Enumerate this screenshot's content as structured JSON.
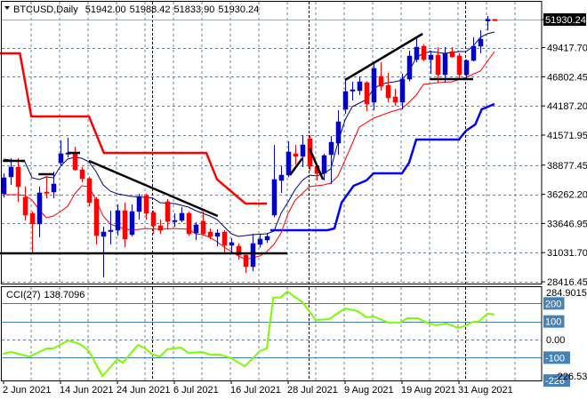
{
  "header": {
    "symbol": "BTCUSD,Daily",
    "open": "51942.00",
    "high": "51988.42",
    "low": "51833.90",
    "close": "51930.24"
  },
  "colors": {
    "bull": "#0000c8",
    "bear": "#ff0000",
    "ma_fast": "#000080",
    "ma_slow": "#ff0000",
    "stop_red": "#ff0000",
    "stop_blue": "#0000ff",
    "cci": "#7cfc00",
    "cci_level": "#4682b4",
    "grid": "#708090"
  },
  "chart_data": [
    {
      "type": "candlestick",
      "title": "BTCUSD,Daily",
      "price_ticks": [
        "51930.24",
        "49417.70",
        "46802.45",
        "44187.20",
        "41571.95",
        "38877.45",
        "36262.20",
        "33646.95",
        "31031.70",
        "28416.45"
      ],
      "current_price": "51930.24",
      "ylim": [
        28416.45,
        51930.24
      ],
      "x_labels": [
        {
          "bar": 1,
          "label": "2 Jun 2021"
        },
        {
          "bar": 9,
          "label": "14 Jun 2021"
        },
        {
          "bar": 17,
          "label": "24 Jun 2021"
        },
        {
          "bar": 25,
          "label": "6 Jul 2021"
        },
        {
          "bar": 33,
          "label": "16 Jul 2021"
        },
        {
          "bar": 41,
          "label": "28 Jul 2021"
        },
        {
          "bar": 49,
          "label": "9 Aug 2021"
        },
        {
          "bar": 57,
          "label": "19 Aug 2021"
        },
        {
          "bar": 65,
          "label": "31 Aug 2021"
        }
      ],
      "period_separators_bar": [
        21.9,
        43.9,
        65.9
      ],
      "ohlc": [
        [
          36309,
          38142,
          35990,
          37743
        ],
        [
          37823,
          39497,
          37105,
          38700
        ],
        [
          38700,
          39497,
          35592,
          36946
        ],
        [
          35990,
          36946,
          33918,
          34396
        ],
        [
          34555,
          34714,
          30969,
          33599
        ],
        [
          33599,
          36946,
          32403,
          36388
        ],
        [
          36468,
          37902,
          35910,
          36388
        ],
        [
          36468,
          38301,
          35910,
          37185
        ],
        [
          39098,
          41091,
          38779,
          39895
        ],
        [
          39895,
          41330,
          39576,
          39975
        ],
        [
          39975,
          40533,
          38380,
          38460
        ],
        [
          38460,
          38700,
          37345,
          37663
        ],
        [
          37663,
          37823,
          35193,
          35512
        ],
        [
          35831,
          35990,
          31766,
          32562
        ],
        [
          32483,
          33360,
          28819,
          32881
        ],
        [
          33000,
          34794,
          31766,
          33041
        ],
        [
          33041,
          35352,
          32562,
          34794
        ],
        [
          34794,
          35512,
          31527,
          32244
        ],
        [
          32642,
          35352,
          32483,
          34714
        ],
        [
          34714,
          36309,
          33997,
          36070
        ],
        [
          36149,
          36309,
          33997,
          34555
        ],
        [
          34635,
          34794,
          32722,
          33439
        ],
        [
          33439,
          33997,
          32722,
          33041
        ],
        [
          35592,
          35831,
          33120,
          33838
        ],
        [
          33838,
          34555,
          33360,
          33918
        ],
        [
          33918,
          35113,
          33758,
          34555
        ],
        [
          34555,
          34714,
          32562,
          32722
        ],
        [
          32802,
          33758,
          32164,
          33519
        ],
        [
          33838,
          34714,
          32562,
          32722
        ],
        [
          32881,
          33200,
          32244,
          32483
        ],
        [
          32483,
          33120,
          31606,
          32802
        ],
        [
          32881,
          33041,
          31049,
          31686
        ],
        [
          31686,
          32324,
          30969,
          31925
        ],
        [
          31606,
          31845,
          30410,
          30810
        ],
        [
          30810,
          31049,
          29215,
          29773
        ],
        [
          29773,
          32722,
          29374,
          31845
        ],
        [
          31766,
          32722,
          31500,
          32244
        ],
        [
          32164,
          32802,
          31900,
          32483
        ],
        [
          34396,
          40692,
          34200,
          37584
        ],
        [
          37504,
          38779,
          36388,
          37982
        ],
        [
          37982,
          41011,
          37800,
          40054
        ],
        [
          39895,
          40692,
          38939,
          39656
        ],
        [
          39656,
          41569,
          38700,
          40692
        ],
        [
          41250,
          41569,
          38380,
          38779
        ],
        [
          38779,
          38900,
          37504,
          38142
        ],
        [
          38142,
          39895,
          37504,
          39736
        ],
        [
          39815,
          41489,
          37185,
          40931
        ],
        [
          40851,
          43800,
          39815,
          42764
        ],
        [
          43880,
          46590,
          43481,
          45474
        ],
        [
          45554,
          46351,
          44677,
          45633
        ],
        [
          45554,
          46829,
          45155,
          46351
        ],
        [
          46271,
          46400,
          43721,
          44358
        ],
        [
          44517,
          48104,
          43800,
          47546
        ],
        [
          46829,
          48104,
          45554,
          45952
        ],
        [
          46032,
          47148,
          44517,
          44916
        ],
        [
          44996,
          45713,
          44200,
          44517
        ],
        [
          44517,
          47068,
          43880,
          46590
        ],
        [
          46590,
          49140,
          46400,
          48662
        ],
        [
          48343,
          50415,
          48104,
          49459
        ],
        [
          49539,
          49698,
          48200,
          48343
        ],
        [
          48343,
          49140,
          47068,
          48742
        ],
        [
          48742,
          49459,
          46271,
          46988
        ],
        [
          46988,
          49459,
          46271,
          48901
        ],
        [
          49060,
          49459,
          48500,
          48582
        ],
        [
          48662,
          48901,
          46670,
          46988
        ],
        [
          46988,
          48343,
          46510,
          48263
        ],
        [
          48263,
          50336,
          48183,
          49539
        ],
        [
          49539,
          50973,
          48901,
          50176
        ],
        [
          51800,
          52248,
          50973,
          51950
        ],
        [
          51942.0,
          51988.42,
          51833.9,
          51930.24
        ]
      ],
      "ma_fast": [
        [
          1,
          39417
        ],
        [
          4,
          39178
        ],
        [
          5,
          37743
        ],
        [
          6,
          37584
        ],
        [
          7,
          37823
        ],
        [
          8,
          37743
        ],
        [
          9,
          38779
        ],
        [
          10,
          39417
        ],
        [
          11,
          39576
        ],
        [
          12,
          39497
        ],
        [
          13,
          39178
        ],
        [
          14,
          38301
        ],
        [
          15,
          37105
        ],
        [
          16,
          36548
        ],
        [
          17,
          36309
        ],
        [
          19,
          36070
        ],
        [
          21,
          35990
        ],
        [
          22,
          35910
        ],
        [
          23,
          35512
        ],
        [
          25,
          35432
        ],
        [
          26,
          35272
        ],
        [
          27,
          35113
        ],
        [
          28,
          34794
        ],
        [
          29,
          34555
        ],
        [
          30,
          34316
        ],
        [
          31,
          33997
        ],
        [
          32,
          33360
        ],
        [
          33,
          32722
        ],
        [
          34,
          32483
        ],
        [
          36,
          32642
        ],
        [
          38,
          32722
        ],
        [
          39,
          32961
        ],
        [
          40,
          34555
        ],
        [
          41,
          35592
        ],
        [
          42,
          36707
        ],
        [
          43,
          37504
        ],
        [
          44,
          37982
        ],
        [
          45,
          37902
        ],
        [
          46,
          38142
        ],
        [
          47,
          38540
        ],
        [
          48,
          40931
        ],
        [
          49,
          42924
        ],
        [
          50,
          44119
        ],
        [
          51,
          44438
        ],
        [
          52,
          44757
        ],
        [
          53,
          45713
        ],
        [
          54,
          46112
        ],
        [
          55,
          46271
        ],
        [
          56,
          46351
        ],
        [
          57,
          46510
        ],
        [
          58,
          47307
        ],
        [
          59,
          48502
        ],
        [
          60,
          48901
        ],
        [
          61,
          49060
        ],
        [
          63,
          48901
        ],
        [
          65,
          49060
        ],
        [
          66,
          49060
        ],
        [
          67,
          49539
        ],
        [
          68,
          50336
        ],
        [
          69,
          50655
        ],
        [
          70,
          50814
        ]
      ],
      "ma_slow": [
        [
          1,
          36229
        ],
        [
          3,
          36229
        ],
        [
          4,
          36149
        ],
        [
          5,
          35750
        ],
        [
          6,
          34874
        ],
        [
          7,
          34157
        ],
        [
          8,
          34316
        ],
        [
          9,
          34714
        ],
        [
          10,
          35193
        ],
        [
          11,
          36309
        ],
        [
          12,
          37026
        ],
        [
          13,
          36946
        ],
        [
          14,
          35750
        ],
        [
          15,
          34316
        ],
        [
          16,
          33599
        ],
        [
          17,
          33360
        ],
        [
          19,
          33041
        ],
        [
          21,
          33200
        ],
        [
          23,
          33120
        ],
        [
          25,
          33200
        ],
        [
          27,
          33120
        ],
        [
          28,
          32722
        ],
        [
          29,
          32642
        ],
        [
          30,
          32403
        ],
        [
          31,
          32005
        ],
        [
          32,
          31527
        ],
        [
          33,
          31128
        ],
        [
          34,
          30729
        ],
        [
          35,
          30410
        ],
        [
          36,
          30570
        ],
        [
          37,
          30729
        ],
        [
          38,
          31128
        ],
        [
          39,
          31766
        ],
        [
          40,
          32802
        ],
        [
          41,
          34555
        ],
        [
          42,
          35750
        ],
        [
          44,
          36946
        ],
        [
          46,
          37105
        ],
        [
          47,
          37265
        ],
        [
          48,
          37902
        ],
        [
          49,
          39337
        ],
        [
          51,
          42286
        ],
        [
          53,
          43083
        ],
        [
          55,
          43561
        ],
        [
          57,
          43960
        ],
        [
          58,
          44517
        ],
        [
          59,
          45155
        ],
        [
          60,
          46112
        ],
        [
          62,
          46271
        ],
        [
          64,
          46351
        ],
        [
          66,
          46749
        ],
        [
          68,
          47307
        ],
        [
          70,
          49060
        ]
      ],
      "stop_red": [
        [
          0.5,
          48901
        ],
        [
          3.3,
          48901
        ],
        [
          4.9,
          43243
        ],
        [
          13,
          43243
        ],
        [
          15.1,
          39975
        ],
        [
          29.5,
          39975
        ],
        [
          31,
          37600
        ],
        [
          35,
          35432
        ],
        [
          38,
          35432
        ]
      ],
      "stop_blue": [
        [
          38.5,
          33041
        ],
        [
          46.5,
          33041
        ],
        [
          47.5,
          33200
        ],
        [
          48.5,
          35512
        ],
        [
          50.2,
          37026
        ],
        [
          52,
          37504
        ],
        [
          53,
          38142
        ],
        [
          57,
          38142
        ],
        [
          58,
          39098
        ],
        [
          59,
          41170
        ],
        [
          65,
          41170
        ],
        [
          66,
          41968
        ],
        [
          67.3,
          42525
        ],
        [
          68.2,
          43880
        ],
        [
          70,
          44358
        ]
      ],
      "trendlines": [
        [
          [
            0.9,
            39257
          ],
          [
            4,
            39257
          ]
        ],
        [
          [
            5.9,
            38062
          ],
          [
            8,
            38062
          ]
        ],
        [
          [
            10,
            39975
          ],
          [
            11.75,
            39975
          ]
        ],
        [
          [
            13,
            39257
          ],
          [
            31.1,
            34316
          ]
        ],
        [
          [
            0.5,
            30969
          ],
          [
            40.9,
            30969
          ]
        ],
        [
          [
            41.25,
            37982
          ],
          [
            43,
            39497
          ]
        ],
        [
          [
            44,
            40374
          ],
          [
            45.9,
            37584
          ]
        ],
        [
          [
            49,
            46510
          ],
          [
            59.9,
            50655
          ]
        ],
        [
          [
            60.9,
            46590
          ],
          [
            67,
            46590
          ]
        ]
      ]
    },
    {
      "type": "line",
      "title": "CCI(27)",
      "value_label": "138.7096",
      "ylim": [
        -226.5353,
        284.9015
      ],
      "ylim_labels": [
        "284.9015",
        "-226.5353"
      ],
      "levels": [
        {
          "v": 200,
          "label": "200"
        },
        {
          "v": 100,
          "label": "100"
        },
        {
          "v": -100,
          "label": "-100"
        },
        {
          "v": -226.5353,
          "label": "-226"
        }
      ],
      "zero_label": "0.00",
      "points": [
        [
          0.9,
          -79
        ],
        [
          2.1,
          -69
        ],
        [
          4.6,
          -94
        ],
        [
          7.1,
          -49
        ],
        [
          8,
          -49
        ],
        [
          10.1,
          -5
        ],
        [
          11.75,
          -25
        ],
        [
          13,
          -64
        ],
        [
          14.9,
          -202
        ],
        [
          17,
          -108
        ],
        [
          17.75,
          -128
        ],
        [
          19.9,
          -30
        ],
        [
          20.9,
          -49
        ],
        [
          22,
          -84
        ],
        [
          23,
          -94
        ],
        [
          24,
          -54
        ],
        [
          25.9,
          -44
        ],
        [
          27,
          -74
        ],
        [
          28.9,
          -69
        ],
        [
          30.1,
          -84
        ],
        [
          31.5,
          -84
        ],
        [
          33,
          -103
        ],
        [
          34.9,
          -148
        ],
        [
          36.4,
          -89
        ],
        [
          37,
          -64
        ],
        [
          38,
          -49
        ],
        [
          38.9,
          232
        ],
        [
          39.9,
          232
        ],
        [
          40.9,
          266
        ],
        [
          41.75,
          241
        ],
        [
          43,
          207
        ],
        [
          44.9,
          108
        ],
        [
          46.75,
          113
        ],
        [
          49,
          172
        ],
        [
          50.75,
          158
        ],
        [
          52,
          123
        ],
        [
          53,
          128
        ],
        [
          55.1,
          94
        ],
        [
          56.75,
          94
        ],
        [
          57.75,
          118
        ],
        [
          59.25,
          118
        ],
        [
          60.5,
          94
        ],
        [
          61.75,
          79
        ],
        [
          63.25,
          89
        ],
        [
          64.9,
          64
        ],
        [
          65.75,
          74
        ],
        [
          67,
          99
        ],
        [
          67.75,
          99
        ],
        [
          69,
          143
        ],
        [
          70,
          139
        ]
      ]
    }
  ]
}
